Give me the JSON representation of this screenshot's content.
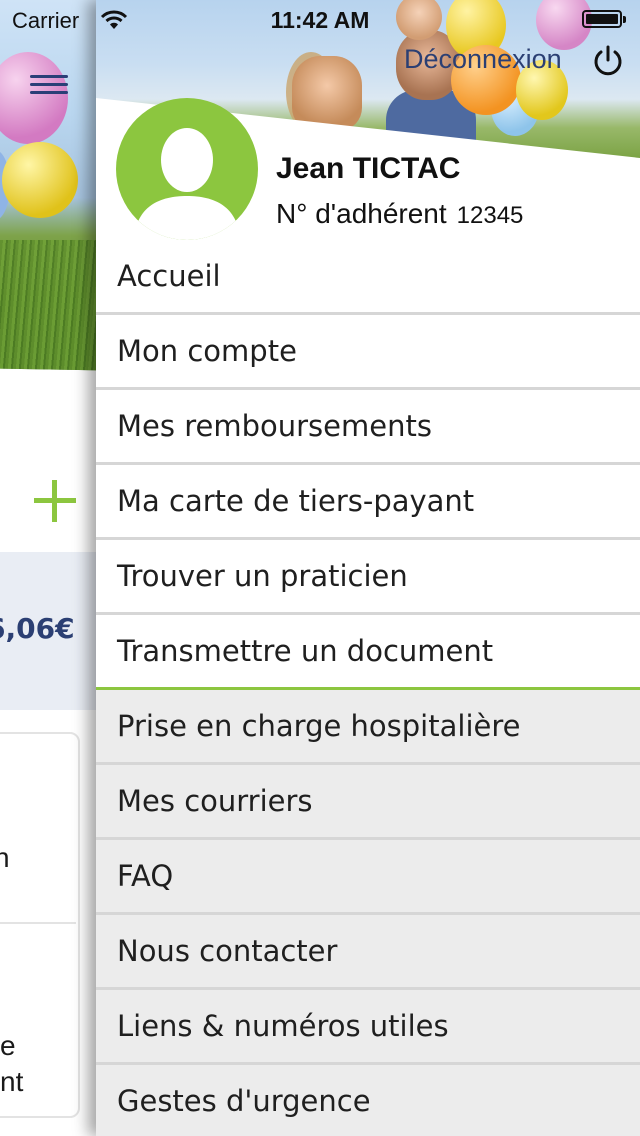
{
  "status_bar": {
    "carrier": "Carrier",
    "time": "11:42 AM"
  },
  "background_screen": {
    "amount": "6,06€",
    "fragment_1": "n",
    "fragment_2": "e",
    "fragment_3": "nt"
  },
  "menu": {
    "logout_label": "Déconnexion",
    "user": {
      "name": "Jean TICTAC",
      "member_label": "N° d'adhérent",
      "member_number": "12345"
    },
    "items": [
      {
        "label": "Accueil"
      },
      {
        "label": "Mon compte"
      },
      {
        "label": "Mes remboursements"
      },
      {
        "label": "Ma carte de tiers-payant"
      },
      {
        "label": "Trouver un praticien"
      },
      {
        "label": "Transmettre un document"
      },
      {
        "label": "Prise en charge hospitalière"
      },
      {
        "label": "Mes courriers"
      },
      {
        "label": "FAQ"
      },
      {
        "label": "Nous contacter"
      },
      {
        "label": "Liens & numéros utiles"
      },
      {
        "label": "Gestes d'urgence"
      }
    ]
  },
  "colors": {
    "accent_green": "#8cc63f",
    "navy": "#2b3f73",
    "menu_grey": "#ececec"
  }
}
